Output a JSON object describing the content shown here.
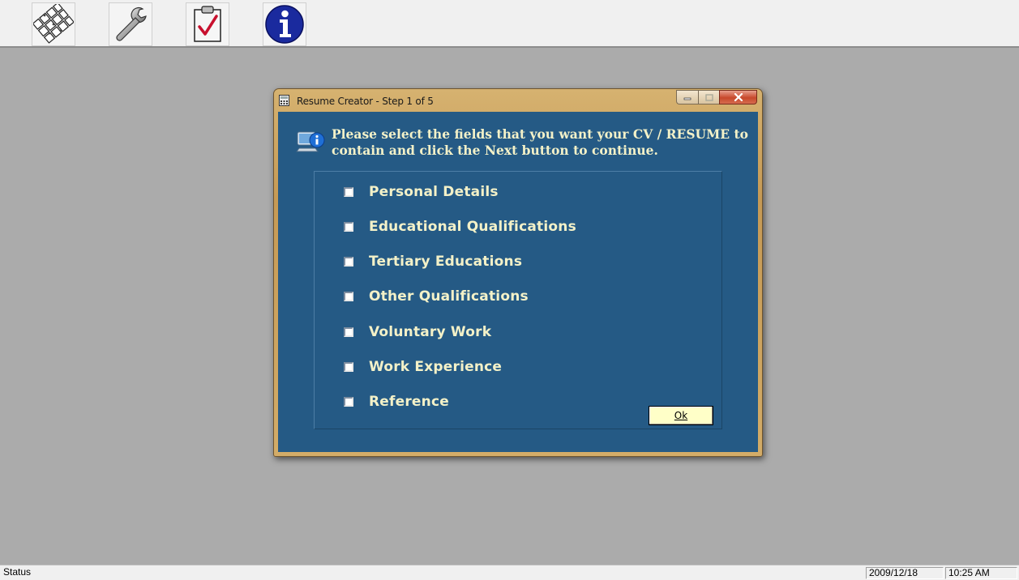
{
  "toolbar": {
    "buttons": [
      {
        "icon": "keypad-icon",
        "label": ""
      },
      {
        "icon": "wrench-icon",
        "label": ""
      },
      {
        "icon": "clipboard-check-icon",
        "label": ""
      },
      {
        "icon": "info-icon",
        "label": ""
      }
    ]
  },
  "dialog": {
    "title": "Resume Creator - Step 1 of 5",
    "instruction": "Please select the fields that you want your CV / RESUME to contain and click the Next button to continue.",
    "fields": [
      {
        "label": "Personal Details",
        "checked": false
      },
      {
        "label": "Educational Qualifications",
        "checked": false
      },
      {
        "label": "Tertiary Educations",
        "checked": false
      },
      {
        "label": "Other Qualifications",
        "checked": false
      },
      {
        "label": "Voluntary Work",
        "checked": false
      },
      {
        "label": "Work Experience",
        "checked": false
      },
      {
        "label": "Reference",
        "checked": false
      }
    ],
    "ok_label": "Ok"
  },
  "statusbar": {
    "status": "Status",
    "date": "2009/12/18",
    "time": "10:25 AM"
  },
  "colors": {
    "desktop": "#ababab",
    "dialog_client": "#255a85",
    "label_text": "#f3f1c8",
    "ok_button": "#ffffc8"
  }
}
